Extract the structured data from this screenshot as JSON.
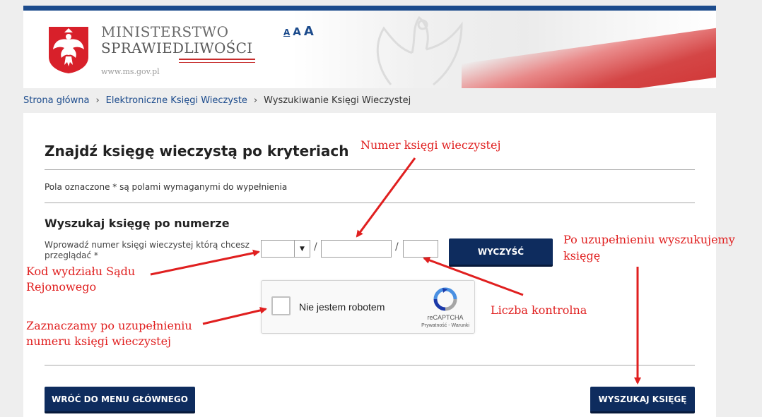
{
  "header": {
    "ministry_line1": "MINISTERSTWO",
    "ministry_line2": "SPRAWIEDLIWOŚCI",
    "url": "www.ms.gov.pl",
    "font_size_small": "A",
    "font_size_medium": "A",
    "font_size_large": "A"
  },
  "breadcrumb": {
    "items": [
      "Strona główna",
      "Elektroniczne Księgi Wieczyste",
      "Wyszukiwanie Księgi Wieczystej"
    ]
  },
  "main": {
    "title": "Znajdź księgę wieczystą po kryteriach",
    "required_note": "Pola oznaczone * są polami wymaganymi do wypełnienia",
    "section_title": "Wyszukaj księgę po numerze",
    "field_label": "Wprowadź numer księgi wieczystej którą chcesz przeglądać *",
    "court_code_value": "",
    "book_number_value": "",
    "check_digit_value": "",
    "separator": "/",
    "clear_button": "WYCZYŚĆ",
    "captcha": {
      "label": "Nie jestem robotem",
      "brand": "reCAPTCHA",
      "links": "Prywatność - Warunki"
    },
    "back_button": "WRÓĆ DO MENU GŁÓWNEGO",
    "search_button": "WYSZUKAJ KSIĘGĘ"
  },
  "annotations": {
    "book_number": "Numer księgi wieczystej",
    "court_code_line1": "Kod wydziału Sądu",
    "court_code_line2": "Rejonowego",
    "after_fill_line1": "Po uzupełnieniu wyszukujemy",
    "after_fill_line2": "księgę",
    "check_digit": "Liczba kontrolna",
    "captcha_hint_line1": "Zaznaczamy po uzupełnieniu",
    "captcha_hint_line2": "numeru księgi wieczystej"
  },
  "colors": {
    "brand_blue": "#1c4b8c",
    "button_navy": "#0e2c5e",
    "annotation_red": "#e01f1f"
  }
}
